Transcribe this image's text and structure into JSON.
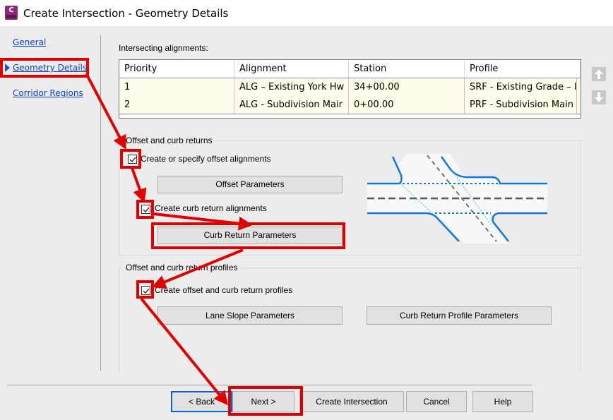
{
  "window": {
    "title": "Create Intersection - Geometry Details",
    "app_icon": "civil-3d-icon"
  },
  "nav": {
    "items": [
      {
        "label": "General",
        "active": false
      },
      {
        "label": "Geometry Details",
        "active": true
      },
      {
        "label": "Corridor Regions",
        "active": false
      }
    ]
  },
  "alignments": {
    "label": "Intersecting alignments:",
    "columns": [
      "Priority",
      "Alignment",
      "Station",
      "Profile"
    ],
    "rows": [
      {
        "priority": "1",
        "alignment": "ALG – Existing York Hw",
        "station": "34+00.00",
        "profile": "SRF - Existing Grade – I"
      },
      {
        "priority": "2",
        "alignment": "ALG - Subdivision Mair",
        "station": "0+00.00",
        "profile": "PRF - Subdivision Main"
      }
    ],
    "move_up": "arrow-up-icon",
    "move_down": "arrow-down-icon"
  },
  "offset_group": {
    "title": "Offset and curb returns",
    "create_offset": {
      "label": "Create or specify offset alignments",
      "checked": true
    },
    "offset_params_button": "Offset Parameters",
    "create_curb": {
      "label": "Create curb return alignments",
      "checked": true
    },
    "curb_params_button": "Curb Return Parameters"
  },
  "profiles_group": {
    "title": "Offset and curb return profiles",
    "create_profiles": {
      "label": "Create offset and curb return profiles",
      "checked": true
    },
    "lane_slope_button": "Lane Slope Parameters",
    "curb_profile_button": "Curb Return Profile Parameters"
  },
  "footer": {
    "back": "< Back",
    "next": "Next >",
    "create": "Create Intersection",
    "cancel": "Cancel",
    "help": "Help"
  },
  "colors": {
    "highlight": "#e00000",
    "link": "#0b3fc6",
    "road_edge": "#1177dd"
  }
}
